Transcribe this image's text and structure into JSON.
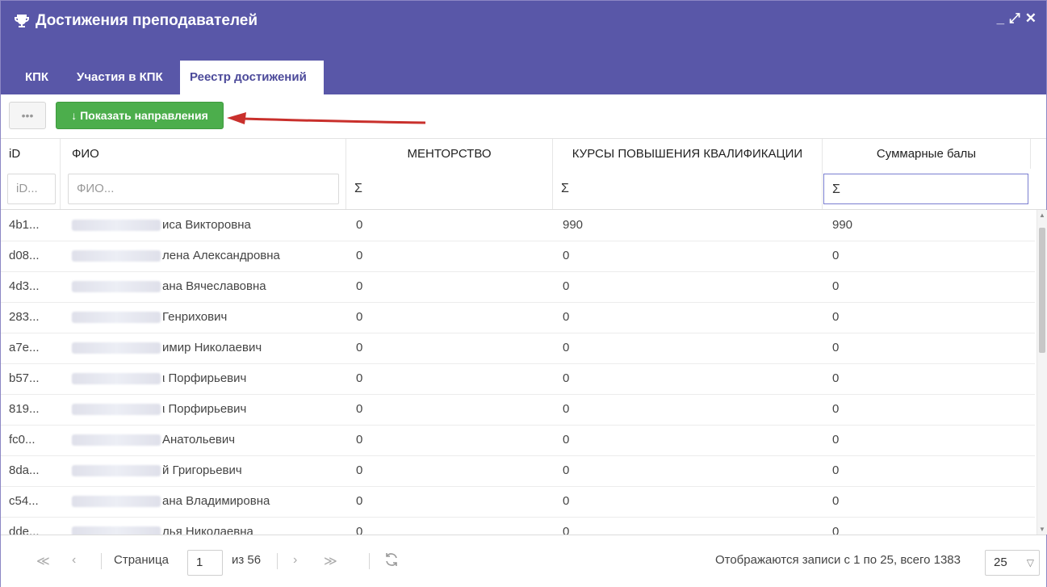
{
  "window": {
    "title": "Достижения преподавателей",
    "controls": [
      "_",
      "⤢",
      "✕"
    ]
  },
  "tabs": [
    {
      "label": "КПК",
      "active": false
    },
    {
      "label": "Участия в КПК",
      "active": false
    },
    {
      "label": "Реестр достижений",
      "active": true
    }
  ],
  "toolbar": {
    "more_label": "•••",
    "show_directions_label": "↓ Показать направления"
  },
  "columns": {
    "id": "iD",
    "fio": "ФИО",
    "mentorship": "МЕНТОРСТВО",
    "courses": "КУРСЫ ПОВЫШЕНИЯ КВАЛИФИКАЦИИ",
    "total": "Суммарные балы"
  },
  "filters": {
    "id_placeholder": "iD...",
    "fio_placeholder": "ФИО...",
    "sigma": "Σ"
  },
  "rows": [
    {
      "id": "4b1...",
      "fio": "иса Викторовна",
      "mentorship": "0",
      "courses": "990",
      "total": "990"
    },
    {
      "id": "d08...",
      "fio": "лена Александровна",
      "mentorship": "0",
      "courses": "0",
      "total": "0"
    },
    {
      "id": "4d3...",
      "fio": "ана Вячеславовна",
      "mentorship": "0",
      "courses": "0",
      "total": "0"
    },
    {
      "id": "283...",
      "fio": "Генрихович",
      "mentorship": "0",
      "courses": "0",
      "total": "0"
    },
    {
      "id": "a7e...",
      "fio": "имир Николаевич",
      "mentorship": "0",
      "courses": "0",
      "total": "0"
    },
    {
      "id": "b57...",
      "fio": "ι Порфирьевич",
      "mentorship": "0",
      "courses": "0",
      "total": "0"
    },
    {
      "id": "819...",
      "fio": "ι Порфирьевич",
      "mentorship": "0",
      "courses": "0",
      "total": "0"
    },
    {
      "id": "fc0...",
      "fio": "Анатольевич",
      "mentorship": "0",
      "courses": "0",
      "total": "0"
    },
    {
      "id": "8da...",
      "fio": "й Григорьевич",
      "mentorship": "0",
      "courses": "0",
      "total": "0"
    },
    {
      "id": "c54...",
      "fio": "ана Владимировна",
      "mentorship": "0",
      "courses": "0",
      "total": "0"
    },
    {
      "id": "dde...",
      "fio": "лья Николаевна",
      "mentorship": "0",
      "courses": "0",
      "total": "0"
    }
  ],
  "pager": {
    "page_label": "Страница",
    "page": "1",
    "of_label": "из 56",
    "records_text": "Отображаются записи с 1 по 25, всего 1383",
    "page_size": "25"
  },
  "colors": {
    "header": "#5957a8",
    "accent_button": "#4cae4c",
    "arrow": "#c9302c"
  }
}
